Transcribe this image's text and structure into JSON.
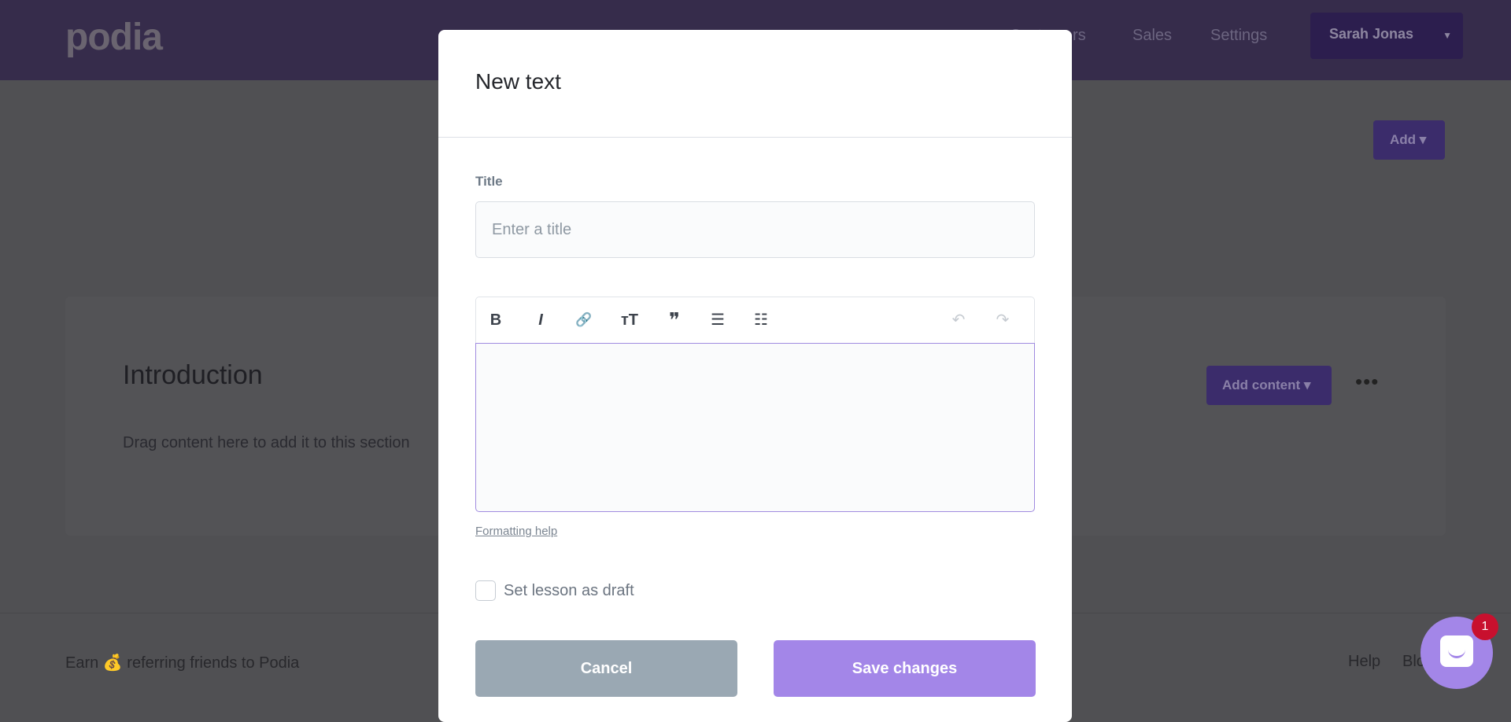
{
  "header": {
    "logo": "podia",
    "nav": [
      {
        "label": "Customers"
      },
      {
        "label": "Sales"
      },
      {
        "label": "Settings"
      }
    ],
    "user": "Sarah Jonas"
  },
  "page": {
    "add_label": "Add ▾",
    "section_title": "Introduction",
    "drag_text": "Drag content here to add it to this section",
    "add_content_label": "Add content ▾"
  },
  "footer": {
    "earn_prefix": "Earn",
    "earn_icon": "money-bag-icon",
    "earn_emoji": "💰",
    "earn_suffix": "referring friends to Podia",
    "links": [
      "Help",
      "Blog"
    ]
  },
  "chat": {
    "badge": "1",
    "color": "#a386e8"
  },
  "modal": {
    "title": "New text",
    "title_label": "Title",
    "title_placeholder": "Enter a title",
    "title_value": "",
    "toolbar": [
      {
        "icon": "bold-icon",
        "glyph": "B"
      },
      {
        "icon": "italic-icon",
        "glyph": "I"
      },
      {
        "icon": "link-icon",
        "glyph": "🔗"
      },
      {
        "icon": "heading-icon",
        "glyph": "тT"
      },
      {
        "icon": "quote-icon",
        "glyph": "❞"
      },
      {
        "icon": "bullet-list-icon",
        "glyph": "☰"
      },
      {
        "icon": "numbered-list-icon",
        "glyph": "☷"
      },
      {
        "icon": "undo-icon",
        "glyph": "↶"
      },
      {
        "icon": "redo-icon",
        "glyph": "↷"
      }
    ],
    "formatting_help": "Formatting help",
    "draft_label": "Set lesson as draft",
    "draft_checked": false,
    "cancel": "Cancel",
    "save": "Save changes",
    "accent": "#a386e8"
  }
}
